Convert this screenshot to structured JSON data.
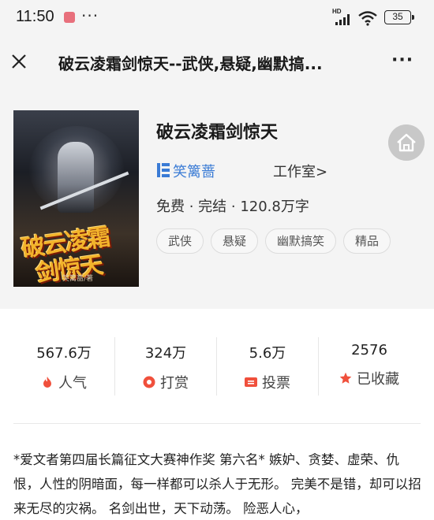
{
  "status_bar": {
    "time": "11:50",
    "more": "···",
    "network_label": "HD",
    "battery": "35",
    "icons": [
      "app-notification-icon",
      "signal-icon",
      "wifi-icon",
      "battery-icon"
    ]
  },
  "title_bar": {
    "title": "破云凌霜剑惊天--武侠,悬疑,幽默搞...",
    "close_icon": "close-icon",
    "more_label": "···"
  },
  "book": {
    "name": "破云凌霜剑惊天",
    "cover_title_line1": "破云凌霜",
    "cover_title_line2": "剑惊天",
    "cover_author": "笑篱蔷/著",
    "author": "笑篱蔷",
    "studio_link": "工作室>",
    "meta": "免费 · 完结 · 120.8万字",
    "tags": [
      "武侠",
      "悬疑",
      "幽默搞笑",
      "精品"
    ]
  },
  "stats": [
    {
      "value": "567.6万",
      "label": "人气",
      "icon": "fire-icon",
      "color": "#f0503c"
    },
    {
      "value": "324万",
      "label": "打赏",
      "icon": "reward-icon",
      "color": "#f0503c"
    },
    {
      "value": "5.6万",
      "label": "投票",
      "icon": "ticket-icon",
      "color": "#f0503c"
    },
    {
      "value": "2576",
      "label": "已收藏",
      "icon": "star-icon",
      "color": "#f0503c"
    }
  ],
  "description": "*爱文者第四届长篇征文大赛神作奖 第六名* 嫉妒、贪婪、虚荣、仇恨，人性的阴暗面，每一样都可以杀人于无形。 完美不是错，却可以招来无尽的灾祸。 名剑出世，天下动荡。 险恶人心，",
  "colors": {
    "accent": "#3a7bd5",
    "stat_icon": "#f0503c",
    "header_bg": "#f4f4f4"
  }
}
